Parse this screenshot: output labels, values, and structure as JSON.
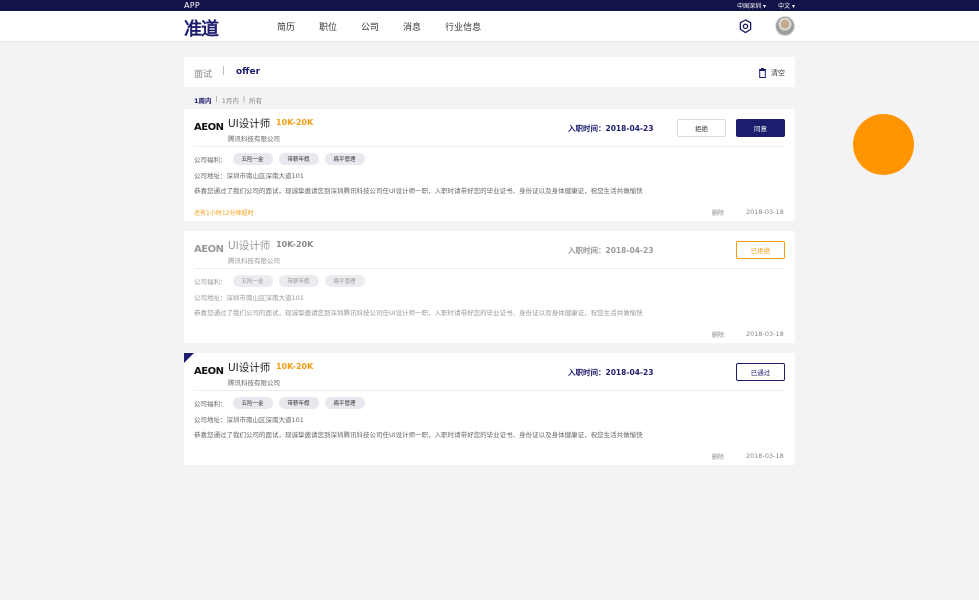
{
  "topbar": {
    "app": "APP",
    "city": "中国深圳",
    "language": "中文"
  },
  "brand": {
    "logo": "准道"
  },
  "nav": [
    "简历",
    "职位",
    "公司",
    "消息",
    "行业信息"
  ],
  "tabs": {
    "interview": "面试",
    "separator": "|",
    "offer": "offer",
    "clear": "清空"
  },
  "filters": [
    "1周内",
    "1月内",
    "所有"
  ],
  "filter_sep": "|",
  "cards": [
    {
      "logo": "AEON",
      "title": "UI设计师",
      "salary": "10K-20K",
      "company": "腾讯科技有限公司",
      "join": "入职时间：2018-04-23",
      "benefits_label": "公司福利：",
      "benefits": [
        "五险一金",
        "带薪年假",
        "扁平管理"
      ],
      "address": "公司地址：深圳市南山区深南大道101",
      "message": "恭喜您通过了我们公司的面试，现诚挚邀请您到深圳腾讯科技公司任UI设计师一职，入职时请带好您的毕业证书、身份证以及身体健康证，祝您生活共做愉快",
      "expire": "还有1小时12分钟超时",
      "delete": "删除",
      "date": "2018-03-18",
      "reject_label": "拒绝",
      "accept_label": "同意"
    },
    {
      "logo": "AEON",
      "title": "UI设计师",
      "salary": "10K-20K",
      "company": "腾讯科技有限公司",
      "join": "入职时间：2018-04-23",
      "benefits_label": "公司福利：",
      "benefits": [
        "五险一金",
        "带薪年假",
        "扁平管理"
      ],
      "address": "公司地址：深圳市南山区深南大道101",
      "message": "恭喜您通过了我们公司的面试，现诚挚邀请您到深圳腾讯科技公司任UI设计师一职，入职时请带好您的毕业证书、身份证以及身体健康证，祝您生活共做愉快",
      "delete": "删除",
      "date": "2018-03-18",
      "status_label": "已拒绝"
    },
    {
      "logo": "AEON",
      "title": "UI设计师",
      "salary": "10K-20K",
      "company": "腾讯科技有限公司",
      "join": "入职时间：2018-04-23",
      "benefits_label": "公司福利：",
      "benefits": [
        "五险一金",
        "带薪年假",
        "扁平管理"
      ],
      "address": "公司地址：深圳市南山区深南大道101",
      "message": "恭喜您通过了我们公司的面试，现诚挚邀请您到深圳腾讯科技公司任UI设计师一职，入职时请带好您的毕业证书、身份证以及身体健康证，祝您生活共做愉快",
      "delete": "删除",
      "date": "2018-03-18",
      "status_label": "已通过"
    }
  ],
  "colors": {
    "brand": "#1d1d6e",
    "accent": "#f39c12",
    "float_button": "#ff9500"
  },
  "icons": {
    "settings": "gear-icon",
    "clear": "trash-icon"
  }
}
